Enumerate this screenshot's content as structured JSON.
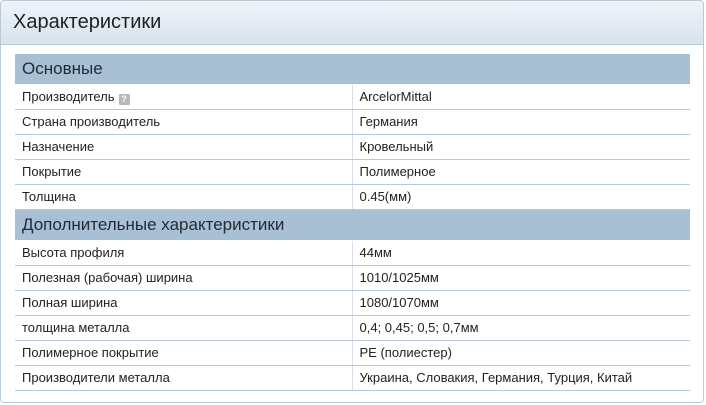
{
  "panel": {
    "title": "Характеристики"
  },
  "sections": [
    {
      "title": "Основные",
      "rows": [
        {
          "key": "Производитель",
          "value": "ArcelorMittal",
          "help": true
        },
        {
          "key": "Страна производитель",
          "value": "Германия"
        },
        {
          "key": "Назначение",
          "value": "Кровельный"
        },
        {
          "key": "Покрытие",
          "value": "Полимерное"
        },
        {
          "key": "Толщина",
          "value": "0.45(мм)"
        }
      ]
    },
    {
      "title": "Дополнительные характеристики",
      "rows": [
        {
          "key": "Высота профиля",
          "value": "44мм"
        },
        {
          "key": "Полезная (рабочая) ширина",
          "value": "1010/1025мм"
        },
        {
          "key": "Полная ширина",
          "value": "1080/1070мм"
        },
        {
          "key": "толщина металла",
          "value": "0,4; 0,45; 0,5; 0,7мм"
        },
        {
          "key": "Полимерное покрытие",
          "value": "PE (полиестер)"
        },
        {
          "key": "Производители металла",
          "value": "Украина, Словакия, Германия, Турция, Китай"
        }
      ]
    }
  ],
  "icons": {
    "help": "question-mark-icon",
    "help_glyph": "?"
  },
  "colors": {
    "section_header": "#a9bfd3",
    "row_border": "#b7c8d8",
    "panel_border": "#b9c9d8"
  }
}
